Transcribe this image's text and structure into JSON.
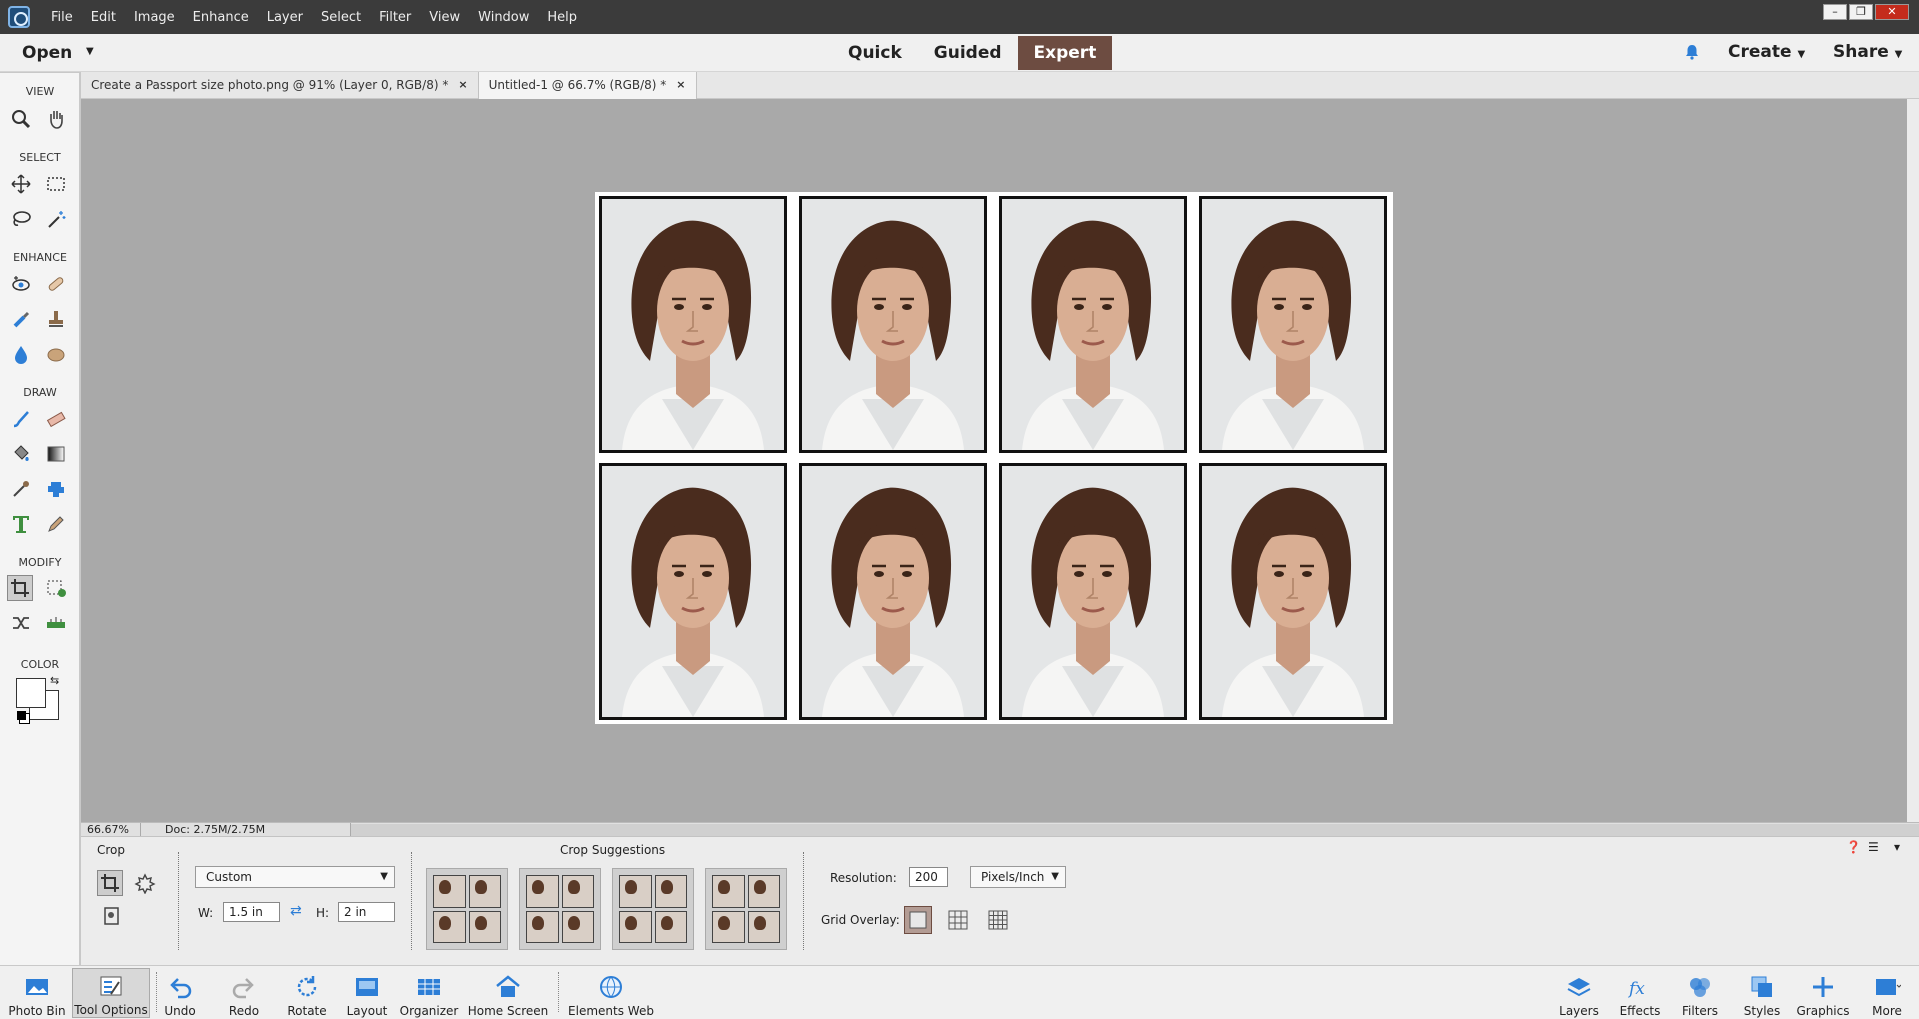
{
  "menu": [
    "File",
    "Edit",
    "Image",
    "Enhance",
    "Layer",
    "Select",
    "Filter",
    "View",
    "Window",
    "Help"
  ],
  "window_controls": {
    "minimize": "–",
    "restore": "❐",
    "close": "✕"
  },
  "topbar": {
    "open": "Open",
    "modes": [
      "Quick",
      "Guided",
      "Expert"
    ],
    "active_mode": "Expert",
    "create": "Create",
    "share": "Share"
  },
  "toolbox": {
    "sections": [
      "VIEW",
      "SELECT",
      "ENHANCE",
      "DRAW",
      "MODIFY",
      "COLOR"
    ]
  },
  "tabs": [
    {
      "label": "Create a Passport size photo.png @ 91% (Layer 0, RGB/8) *",
      "close": "×",
      "active": false
    },
    {
      "label": "Untitled-1 @ 66.7% (RGB/8) *",
      "close": "×",
      "active": true
    }
  ],
  "status": {
    "zoom": "66.67%",
    "doc": "Doc: 2.75M/2.75M"
  },
  "options": {
    "tool_title": "Crop",
    "suggestions_title": "Crop Suggestions",
    "preset": "Custom",
    "w_label": "W:",
    "w_value": "1.5 in",
    "h_label": "H:",
    "h_value": "2 in",
    "res_label": "Resolution:",
    "res_value": "200",
    "res_unit": "Pixels/Inch",
    "grid_label": "Grid Overlay:"
  },
  "bottom_left": [
    "Photo Bin",
    "Tool Options",
    "Undo",
    "Redo",
    "Rotate",
    "Layout",
    "Organizer",
    "Home Screen",
    "Elements Web"
  ],
  "bottom_right": [
    "Layers",
    "Effects",
    "Filters",
    "Styles",
    "Graphics",
    "More"
  ],
  "colors": {
    "accent": "#6d4c41",
    "canvas": "#a9a9a9",
    "menubar": "#3b3b3b"
  }
}
